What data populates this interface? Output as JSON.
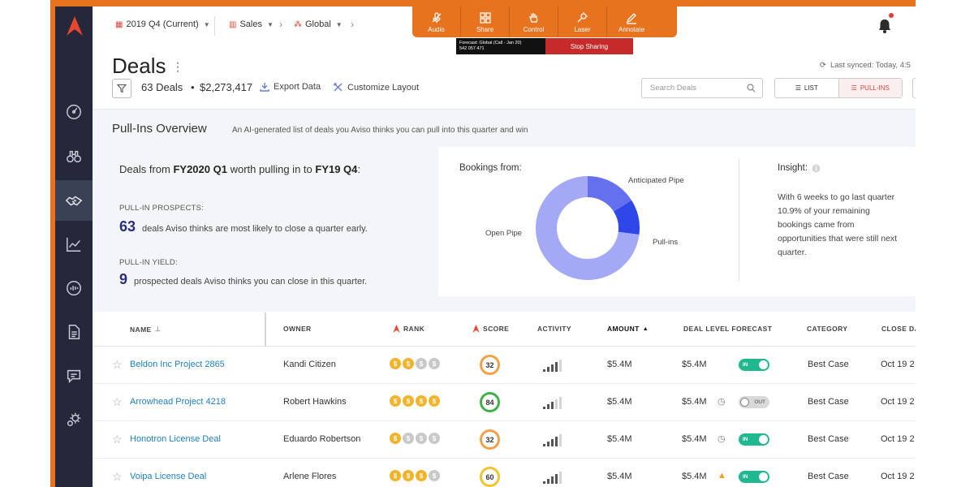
{
  "topbar": {
    "period": "2019 Q4 (Current)",
    "segment": "Sales",
    "region": "Global"
  },
  "screen_share": {
    "buttons": [
      {
        "label": "Audio",
        "icon": "mic-off-icon"
      },
      {
        "label": "Share",
        "icon": "grid-icon"
      },
      {
        "label": "Control",
        "icon": "hand-icon"
      },
      {
        "label": "Laser",
        "icon": "laser-icon"
      },
      {
        "label": "Annotate",
        "icon": "pen-icon"
      }
    ],
    "info_line1": "Forecast: Global (Call - Jan 20)",
    "info_line2": "542 057 471",
    "stop_label": "Stop Sharing"
  },
  "header": {
    "title": "Deals",
    "deal_count": "63 Deals",
    "separator": "•",
    "total_amount": "$2,273,417",
    "export_label": "Export Data",
    "customize_label": "Customize Layout",
    "last_synced": "Last synced:  Today, 4:5",
    "search_placeholder": "Search Deals",
    "view_list": "LIST",
    "view_pullins": "PULL-INS"
  },
  "overview": {
    "title": "Pull-Ins Overview",
    "subtitle": "An AI-generated list of deals you Aviso thinks you can pull into this quarter and win",
    "heading_pre": "Deals from ",
    "heading_from": "FY2020 Q1",
    "heading_mid": " worth pulling in to ",
    "heading_to": "FY19 Q4",
    "heading_post": ":",
    "prospects_label": "PULL-IN PROSPECTS:",
    "prospects_num": "63",
    "prospects_text": "deals Aviso thinks are most likely to close a quarter early.",
    "yield_label": "PULL-IN YIELD:",
    "yield_num": "9",
    "yield_text": "prospected deals Aviso thinks you can close in this quarter.",
    "bookings_title": "Bookings from:",
    "insight_title": "Insight:",
    "insight_text": "With 6 weeks to go last quarter 10.9% of your remaining bookings came from opportunities that were still next quarter."
  },
  "chart_data": {
    "type": "pie",
    "title": "Bookings from:",
    "categories": [
      "Open Pipe",
      "Anticipated Pipe",
      "Pull-ins"
    ],
    "values": [
      73,
      16,
      11
    ],
    "colors": [
      "#a3a9f5",
      "#6470ee",
      "#2f47e8"
    ]
  },
  "table": {
    "headers": {
      "name": "NAME",
      "owner": "OWNER",
      "rank": "RANK",
      "score": "SCORE",
      "activity": "ACTIVITY",
      "amount": "AMOUNT",
      "forecast": "DEAL LEVEL FORECAST",
      "category": "CATEGORY",
      "close": "CLOSE DA"
    },
    "rows": [
      {
        "name": "Beldon Inc Project 2865",
        "owner": "Kandi Citizen",
        "rank": 2,
        "score": "32",
        "score_color": "mid",
        "activity": 4,
        "amount": "$5.4M",
        "forecast_amount": "$5.4M",
        "forecast_icon": "",
        "toggle": "IN",
        "category": "Best Case",
        "close": "Oct 19 2"
      },
      {
        "name": "Arrowhead Project 4218",
        "owner": "Robert Hawkins",
        "rank": 4,
        "score": "84",
        "score_color": "high",
        "activity": 3,
        "amount": "$5.4M",
        "forecast_amount": "$5.4M",
        "forecast_icon": "clock-icon",
        "toggle": "OUT",
        "category": "Best Case",
        "close": "Oct 19 2"
      },
      {
        "name": "Honotron License Deal",
        "owner": "Eduardo Robertson",
        "rank": 1,
        "score": "32",
        "score_color": "mid",
        "activity": 4,
        "amount": "$5.4M",
        "forecast_amount": "$5.4M",
        "forecast_icon": "clock-icon",
        "toggle": "IN",
        "category": "Best Case",
        "close": "Oct 19 2"
      },
      {
        "name": "Voipa License Deal",
        "owner": "Arlene Flores",
        "rank": 3,
        "score": "60",
        "score_color": "yel",
        "activity": 4,
        "amount": "$5.4M",
        "forecast_amount": "$5.4M",
        "forecast_icon": "warning-icon",
        "toggle": "IN",
        "category": "Best Case",
        "close": "Oct 19 2"
      }
    ]
  },
  "colors": {
    "accent": "#e8731e",
    "brand_red": "#d9453a",
    "link": "#1f7fbf",
    "toggle_in": "#1fb88f"
  }
}
